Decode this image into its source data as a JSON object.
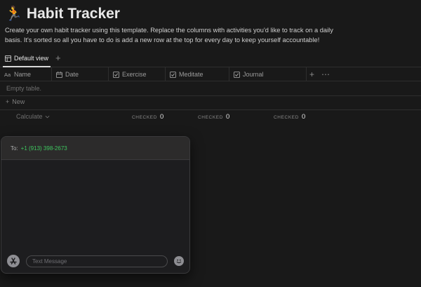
{
  "page": {
    "emoji": "🏃",
    "title": "Habit Tracker",
    "description": "Create your own habit tracker using this template. Replace the columns with activities you'd like to track on a daily basis. It's sorted so all you have to do is add a new row at the top for every day to keep yourself accountable!"
  },
  "views": {
    "active": "Default view",
    "add": "+"
  },
  "columns": [
    "Name",
    "Date",
    "Exercise",
    "Meditate",
    "Journal"
  ],
  "table": {
    "empty": "Empty table.",
    "new_label": "New",
    "calculate_label": "Calculate",
    "checked_label": "CHECKED",
    "checked_values": [
      "0",
      "0",
      "0"
    ]
  },
  "message": {
    "to_label": "To:",
    "to_number": "+1 (913) 398-2673",
    "placeholder": "Text Message"
  },
  "colors": {
    "background": "#191919",
    "accent_green": "#3ec75f"
  }
}
